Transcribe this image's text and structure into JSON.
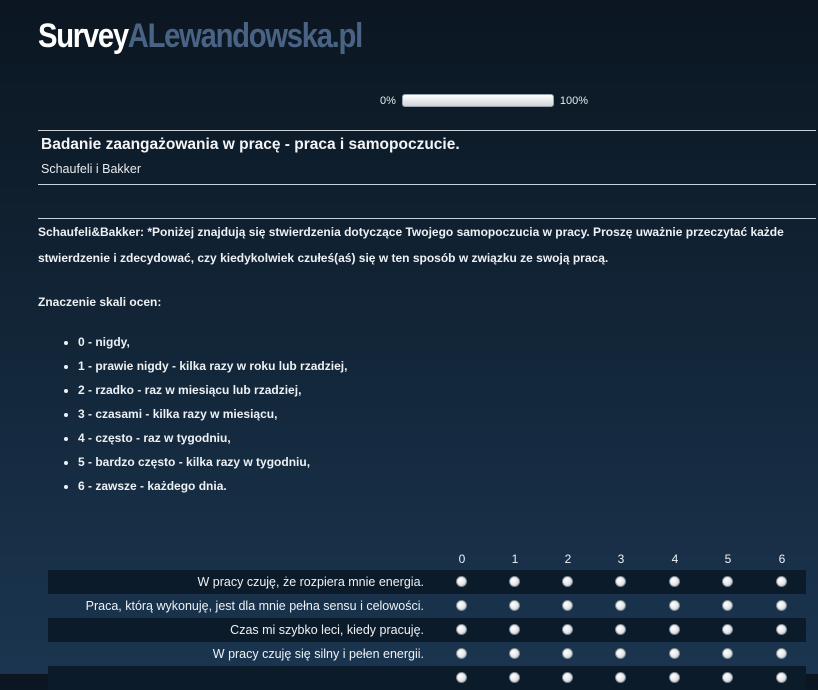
{
  "logo": {
    "part1": "Survey",
    "part2": "ALewandowska.pl"
  },
  "progress": {
    "min_label": "0%",
    "max_label": "100%",
    "value_percent": 0
  },
  "survey": {
    "title": "Badanie zaangażowania w pracę - praca i samopoczucie.",
    "subtitle": "Schaufeli i Bakker"
  },
  "description": {
    "text": "Schaufeli&Bakker: *Poniżej znajdują się stwierdzenia dotyczące Twojego samopoczucia w pracy. Proszę uważnie przeczytać każde stwierdzenie i zdecydować, czy kiedykolwiek czułeś(aś) się w ten sposób w związku ze swoją pracą.",
    "scale_heading": "Znaczenie skali ocen:",
    "scale_items": [
      "0 - nigdy,",
      "1 - prawie nigdy - kilka razy w roku lub rzadziej,",
      "2 - rzadko - raz w miesiącu lub rzadziej,",
      "3 - czasami - kilka razy w miesiącu,",
      "4 - często - raz w tygodniu,",
      "5 - bardzo często - kilka razy w tygodniu,",
      "6 - zawsze - każdego dnia."
    ]
  },
  "matrix": {
    "columns": [
      "0",
      "1",
      "2",
      "3",
      "4",
      "5",
      "6"
    ],
    "rows": [
      "W pracy czuję, że rozpiera mnie energia.",
      "Praca, którą wykonuję, jest dla mnie pełna sensu i celowości.",
      "Czas mi szybko leci, kiedy pracuję.",
      "W pracy czuję się silny i pełen energii.",
      ""
    ]
  }
}
